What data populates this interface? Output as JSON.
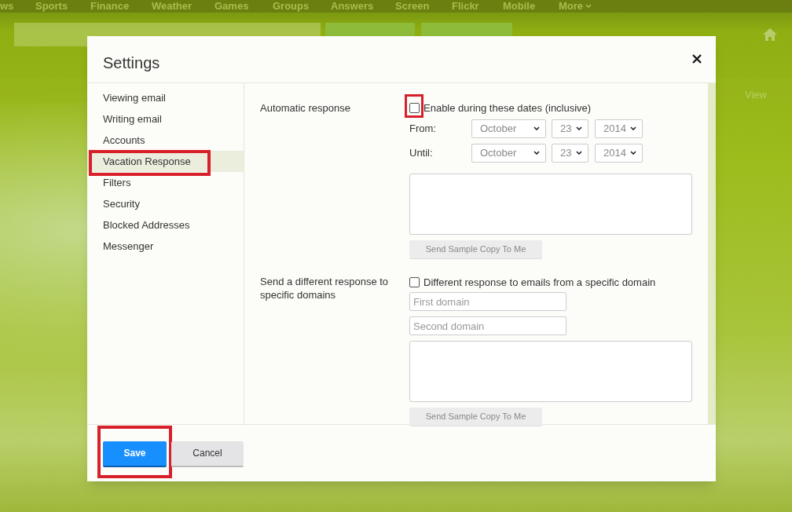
{
  "background": {
    "nav_items": [
      "ws",
      "Sports",
      "Finance",
      "Weather",
      "Games",
      "Groups",
      "Answers",
      "Screen",
      "Flickr",
      "Mobile",
      "More"
    ],
    "view_label": "View"
  },
  "dialog": {
    "title": "Settings",
    "sidebar": {
      "items": [
        {
          "label": "Viewing email",
          "selected": false,
          "highlighted": false
        },
        {
          "label": "Writing email",
          "selected": false,
          "highlighted": false
        },
        {
          "label": "Accounts",
          "selected": false,
          "highlighted": false
        },
        {
          "label": "Vacation Response",
          "selected": true,
          "highlighted": true
        },
        {
          "label": "Filters",
          "selected": false,
          "highlighted": false
        },
        {
          "label": "Security",
          "selected": false,
          "highlighted": false
        },
        {
          "label": "Blocked Addresses",
          "selected": false,
          "highlighted": false
        },
        {
          "label": "Messenger",
          "selected": false,
          "highlighted": false
        }
      ]
    },
    "automatic_response": {
      "label": "Automatic response",
      "checkbox": {
        "label": "Enable during these dates (inclusive)",
        "checked": false,
        "highlighted": true
      },
      "dates": [
        {
          "label": "From:",
          "month": "October",
          "day": "23",
          "year": "2014"
        },
        {
          "label": "Until:",
          "month": "October",
          "day": "23",
          "year": "2014"
        }
      ],
      "button": "Send Sample Copy To Me"
    },
    "domain_response": {
      "label": "Send a different response to specific domains",
      "checkbox": {
        "label": "Different response to emails from a specific domain",
        "checked": false
      },
      "fields": [
        {
          "placeholder": "First domain"
        },
        {
          "placeholder": "Second domain"
        }
      ],
      "button": "Send Sample Copy To Me"
    },
    "buttons": [
      {
        "label": "Save",
        "kind": "primary",
        "highlighted": true
      },
      {
        "label": "Cancel",
        "kind": "secondary",
        "highlighted": false
      }
    ]
  }
}
